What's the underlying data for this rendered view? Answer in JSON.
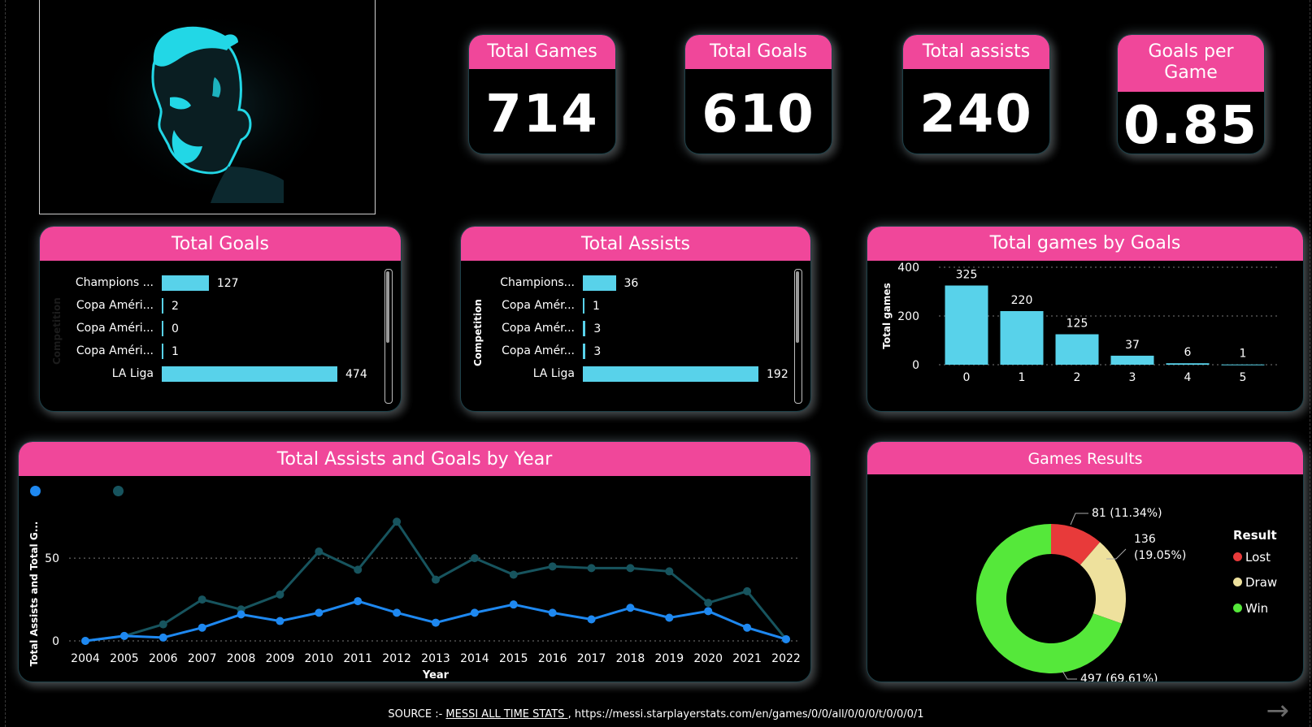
{
  "kpis": [
    {
      "label": "Total Games",
      "value": "714"
    },
    {
      "label": "Total Goals",
      "value": "610"
    },
    {
      "label": "Total assists",
      "value": "240"
    },
    {
      "label": "Goals per Game",
      "value": "0.85"
    }
  ],
  "colors": {
    "accent": "#f0479a",
    "bar": "#58d2ea",
    "assists_line": "#1e88f0",
    "goals_line": "#17545e",
    "lost": "#e83a3a",
    "draw": "#eee19d",
    "win": "#55e83a"
  },
  "logo": {
    "icon": "player-silhouette-icon"
  },
  "goals_panel": {
    "title": "Total Goals",
    "axis_title": "Competition",
    "rows": [
      {
        "label": "Champions ...",
        "value": 127
      },
      {
        "label": "Copa Améri...",
        "value": 2
      },
      {
        "label": "Copa Améri...",
        "value": 0
      },
      {
        "label": "Copa Améri...",
        "value": 1
      },
      {
        "label": "LA Liga",
        "value": 474
      }
    ]
  },
  "assists_panel": {
    "title": "Total Assists",
    "axis_title": "Competition",
    "rows": [
      {
        "label": "Champions...",
        "value": 36
      },
      {
        "label": "Copa Amér...",
        "value": 1
      },
      {
        "label": "Copa Amér...",
        "value": 3
      },
      {
        "label": "Copa Amér...",
        "value": 3
      },
      {
        "label": "LA Liga",
        "value": 192
      }
    ]
  },
  "games_by_goals": {
    "title": "Total games by Goals",
    "chart_data": {
      "type": "bar",
      "categories": [
        "0",
        "1",
        "2",
        "3",
        "4",
        "5"
      ],
      "values": [
        325,
        220,
        125,
        37,
        6,
        1
      ],
      "ylabel": "Total games",
      "ylim": [
        0,
        400
      ],
      "yticks": [
        "0",
        "200",
        "400"
      ],
      "grid": true
    }
  },
  "by_year": {
    "title": "Total Assists and Goals by Year",
    "chart_data": {
      "type": "line",
      "x": [
        "2004",
        "2005",
        "2006",
        "2007",
        "2008",
        "2009",
        "2010",
        "2011",
        "2012",
        "2013",
        "2014",
        "2015",
        "2016",
        "2017",
        "2018",
        "2019",
        "2020",
        "2021",
        "2022"
      ],
      "series": [
        {
          "values": [
            0,
            3,
            2,
            8,
            16,
            12,
            17,
            24,
            17,
            11,
            17,
            22,
            17,
            13,
            20,
            14,
            18,
            8,
            1
          ]
        },
        {
          "values": [
            0,
            3,
            10,
            25,
            19,
            28,
            54,
            43,
            72,
            37,
            50,
            40,
            45,
            44,
            44,
            42,
            23,
            30,
            1
          ]
        }
      ],
      "xlabel": "Year",
      "ylabel": "Total Assists and Total G...",
      "ylim": [
        0,
        80
      ],
      "yticks": [
        "0",
        "50"
      ],
      "grid": true
    }
  },
  "results": {
    "title": "Games Results",
    "legend_title": "Result",
    "chart_data": {
      "type": "pie",
      "categories": [
        "Lost",
        "Draw",
        "Win"
      ],
      "values": [
        81,
        136,
        497
      ],
      "labels": [
        "81 (11.34%)",
        "136",
        "(19.05%)",
        "497 (69.61%)"
      ]
    }
  },
  "source": {
    "prefix": "SOURCE :- ",
    "link_text": "MESSI ALL TIME STATS ",
    "url": ", https://messi.starplayerstats.com/en/games/0/0/all/0/0/0/t/0/0/0/1"
  },
  "nav": {
    "next_icon": "arrow-right-icon",
    "next_glyph": "→"
  }
}
